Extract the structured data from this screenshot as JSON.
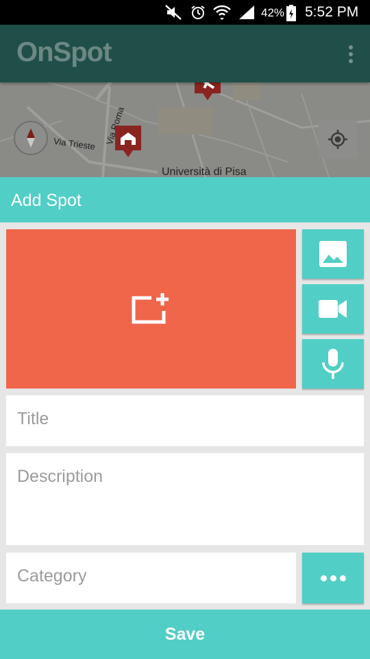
{
  "status_bar": {
    "battery": "42%",
    "time": "5:52 PM",
    "icons": [
      "mute-icon",
      "alarm-icon",
      "wifi-icon",
      "signal-icon",
      "battery-icon"
    ]
  },
  "app_bar": {
    "title": "OnSpot",
    "menu_icon": "overflow-menu-icon"
  },
  "map": {
    "labels": {
      "street_1": "Via Roma",
      "street_2": "Via Trieste",
      "place": "Università di Pisa"
    }
  },
  "add_spot": {
    "title": "Add Spot",
    "media_buttons": [
      "image-icon",
      "video-camera-icon",
      "microphone-icon"
    ],
    "title_placeholder": "Title",
    "description_placeholder": "Description",
    "category_placeholder": "Category",
    "save_label": "Save"
  },
  "colors": {
    "accent": "#51cec5",
    "media_preview": "#ef664b",
    "app_bar_dimmed": "#1f4f48"
  }
}
